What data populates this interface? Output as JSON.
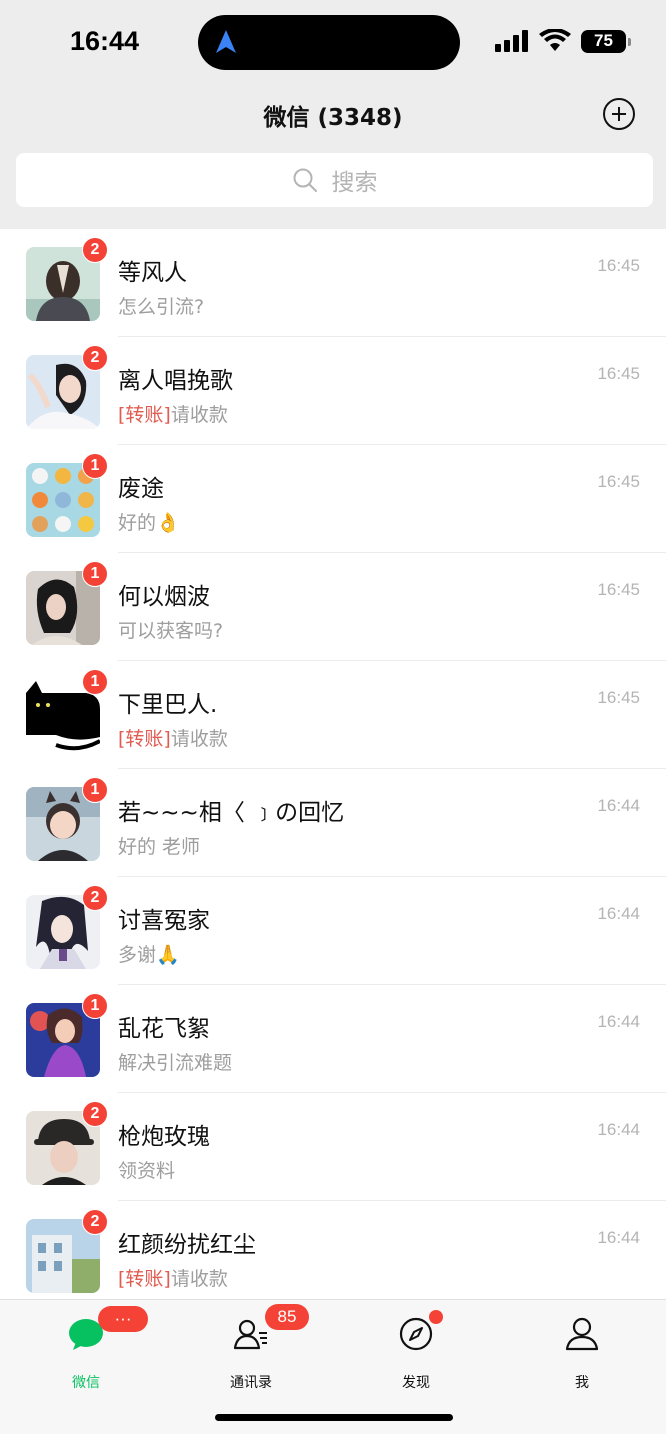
{
  "status_bar": {
    "time": "16:44",
    "battery": "75"
  },
  "header": {
    "title": "微信 (3348)"
  },
  "search": {
    "placeholder": "搜索"
  },
  "chats": [
    {
      "name": "等风人",
      "transfer_tag": "",
      "message": "怎么引流?",
      "time": "16:45",
      "unread": "2"
    },
    {
      "name": "离人唱挽歌",
      "transfer_tag": "[转账]",
      "message": "请收款",
      "time": "16:45",
      "unread": "2"
    },
    {
      "name": "废途",
      "transfer_tag": "",
      "message": "好的👌",
      "time": "16:45",
      "unread": "1"
    },
    {
      "name": "何以烟波",
      "transfer_tag": "",
      "message": "可以获客吗?",
      "time": "16:45",
      "unread": "1"
    },
    {
      "name": "下里巴人.",
      "transfer_tag": "[转账]",
      "message": "请收款",
      "time": "16:45",
      "unread": "1"
    },
    {
      "name": "若~~~相〈 ﹞の回忆",
      "transfer_tag": "",
      "message": "好的 老师",
      "time": "16:44",
      "unread": "1"
    },
    {
      "name": "讨喜冤家",
      "transfer_tag": "",
      "message": "多谢🙏",
      "time": "16:44",
      "unread": "2"
    },
    {
      "name": "乱花飞絮",
      "transfer_tag": "",
      "message": "解决引流难题",
      "time": "16:44",
      "unread": "1"
    },
    {
      "name": "枪炮玫瑰",
      "transfer_tag": "",
      "message": "领资料",
      "time": "16:44",
      "unread": "2"
    },
    {
      "name": "红颜纷扰红尘",
      "transfer_tag": "[转账]",
      "message": "请收款",
      "time": "16:44",
      "unread": "2"
    }
  ],
  "tab_bar": {
    "chats": {
      "label": "微信",
      "badge": "···"
    },
    "contacts": {
      "label": "通讯录",
      "badge": "85"
    },
    "discover": {
      "label": "发现"
    },
    "me": {
      "label": "我"
    }
  },
  "colors": {
    "accent": "#07c160",
    "badge": "#f44336",
    "transfer": "#e25b50"
  }
}
